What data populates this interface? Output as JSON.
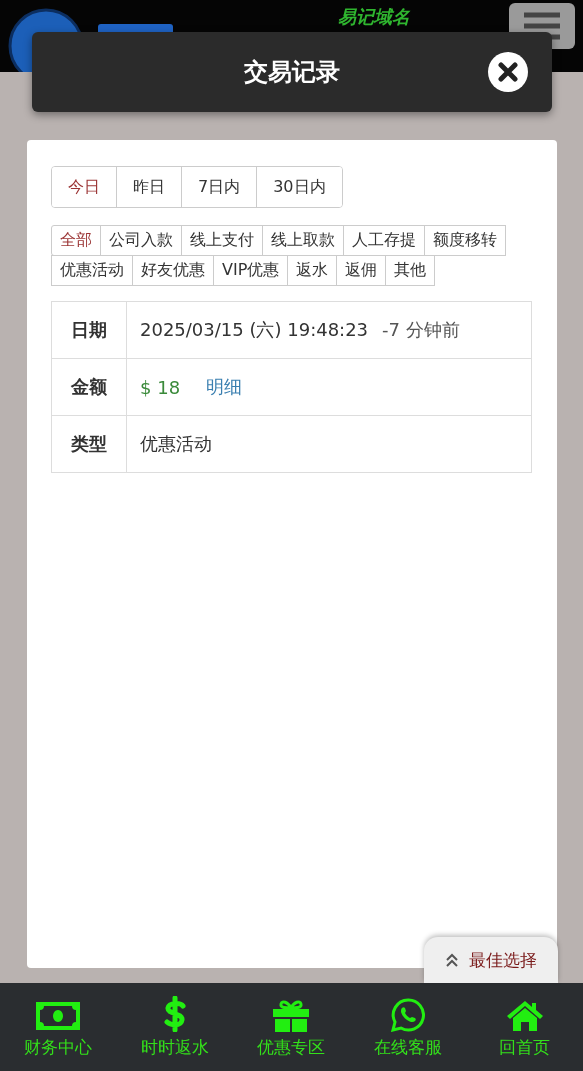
{
  "header": {
    "slogan": "易记域名"
  },
  "dialog": {
    "title": "交易记录"
  },
  "periods": [
    {
      "label": "今日",
      "selected": true
    },
    {
      "label": "昨日",
      "selected": false
    },
    {
      "label": "7日内",
      "selected": false
    },
    {
      "label": "30日内",
      "selected": false
    }
  ],
  "categories": [
    {
      "label": "全部",
      "selected": true
    },
    {
      "label": "公司入款",
      "selected": false
    },
    {
      "label": "线上支付",
      "selected": false
    },
    {
      "label": "线上取款",
      "selected": false
    },
    {
      "label": "人工存提",
      "selected": false
    },
    {
      "label": "额度移转",
      "selected": false
    },
    {
      "label": "优惠活动",
      "selected": false
    },
    {
      "label": "好友优惠",
      "selected": false
    },
    {
      "label": "VIP优惠",
      "selected": false
    },
    {
      "label": "返水",
      "selected": false
    },
    {
      "label": "返佣",
      "selected": false
    },
    {
      "label": "其他",
      "selected": false
    }
  ],
  "record": {
    "date_label": "日期",
    "date": "2025/03/15 (六) 19:48:23",
    "ago": "-7 分钟前",
    "amount_label": "金额",
    "amount": "$ 18",
    "detail_link": "明细",
    "type_label": "类型",
    "type": "优惠活动"
  },
  "float_button": {
    "label": "最佳选择"
  },
  "bottom_nav": [
    {
      "kind": "money",
      "label": "财务中心"
    },
    {
      "kind": "dollar",
      "label": "时时返水"
    },
    {
      "kind": "gift",
      "label": "优惠专区"
    },
    {
      "kind": "chat",
      "label": "在线客服"
    },
    {
      "kind": "home",
      "label": "回首页"
    }
  ]
}
